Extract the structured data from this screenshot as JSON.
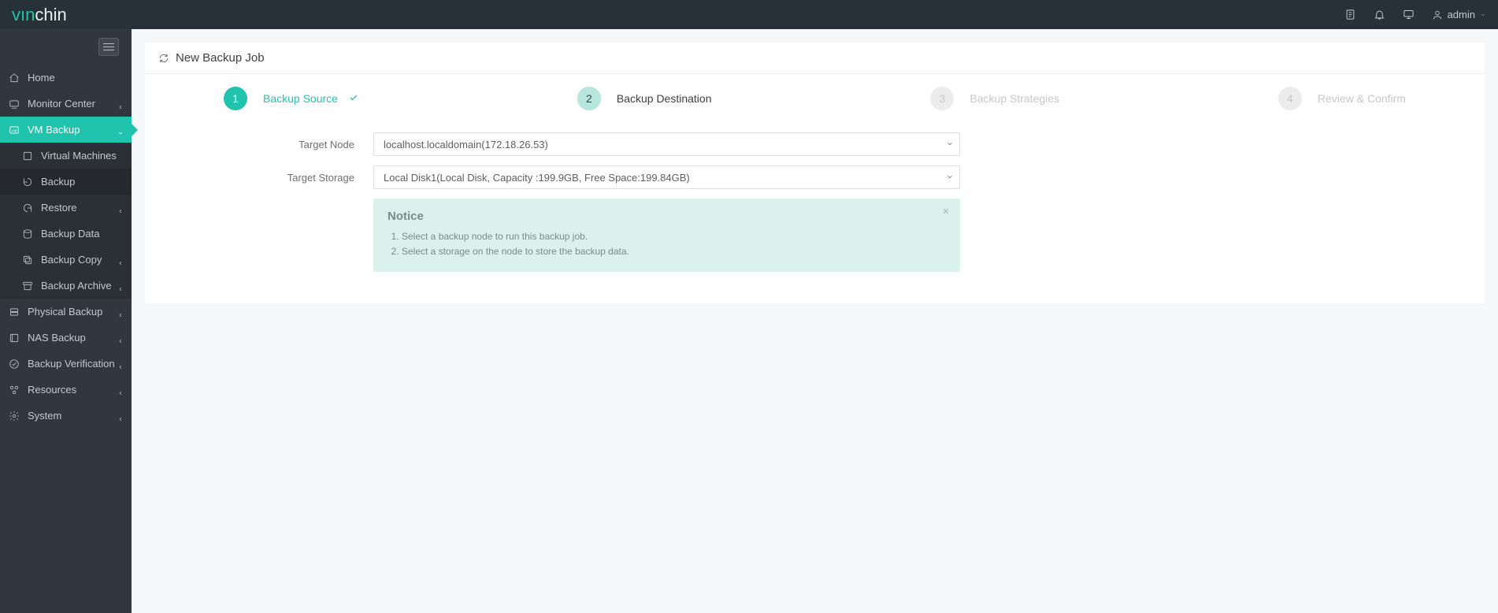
{
  "header": {
    "brand_prefix": "vın",
    "brand_rest": "chin",
    "user": "admin"
  },
  "sidebar": {
    "items": [
      {
        "label": "Home"
      },
      {
        "label": "Monitor Center"
      },
      {
        "label": "VM Backup"
      },
      {
        "label": "Virtual Machines"
      },
      {
        "label": "Backup"
      },
      {
        "label": "Restore"
      },
      {
        "label": "Backup Data"
      },
      {
        "label": "Backup Copy"
      },
      {
        "label": "Backup Archive"
      },
      {
        "label": "Physical Backup"
      },
      {
        "label": "NAS Backup"
      },
      {
        "label": "Backup Verification"
      },
      {
        "label": "Resources"
      },
      {
        "label": "System"
      }
    ]
  },
  "page": {
    "title": "New Backup Job"
  },
  "steps": [
    {
      "num": "1",
      "label": "Backup Source"
    },
    {
      "num": "2",
      "label": "Backup Destination"
    },
    {
      "num": "3",
      "label": "Backup Strategies"
    },
    {
      "num": "4",
      "label": "Review & Confirm"
    }
  ],
  "form": {
    "target_node_label": "Target Node",
    "target_node_value": "localhost.localdomain(172.18.26.53)",
    "target_storage_label": "Target Storage",
    "target_storage_value": "Local Disk1(Local Disk, Capacity :199.9GB, Free Space:199.84GB)"
  },
  "notice": {
    "title": "Notice",
    "items": [
      "Select a backup node to run this backup job.",
      "Select a storage on the node to store the backup data."
    ]
  }
}
